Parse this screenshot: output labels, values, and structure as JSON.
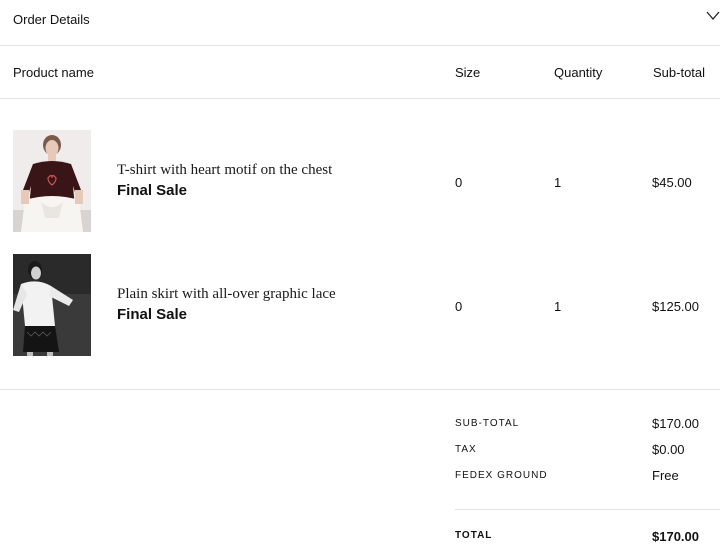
{
  "header": {
    "title": "Order Details",
    "toggle_icon": "chevron-down-icon"
  },
  "columns": {
    "product": "Product name",
    "size": "Size",
    "quantity": "Quantity",
    "subtotal": "Sub-total"
  },
  "items": [
    {
      "name": "T-shirt with heart motif on the chest",
      "badge": "Final Sale",
      "size": "0",
      "quantity": "1",
      "subtotal": "$45.00",
      "image": "model wearing dark burgundy t-shirt with white top tied at waist"
    },
    {
      "name": "Plain skirt with all-over graphic lace",
      "badge": "Final Sale",
      "size": "0",
      "quantity": "1",
      "subtotal": "$125.00",
      "image": "black and white photo of model in white shirt and black lace skirt"
    }
  ],
  "summary": {
    "subtotal_label": "SUB-TOTAL",
    "subtotal_value": "$170.00",
    "tax_label": "TAX",
    "tax_value": "$0.00",
    "shipping_label": "FEDEX GROUND",
    "shipping_value": "Free",
    "total_label": "TOTAL",
    "total_value": "$170.00"
  }
}
